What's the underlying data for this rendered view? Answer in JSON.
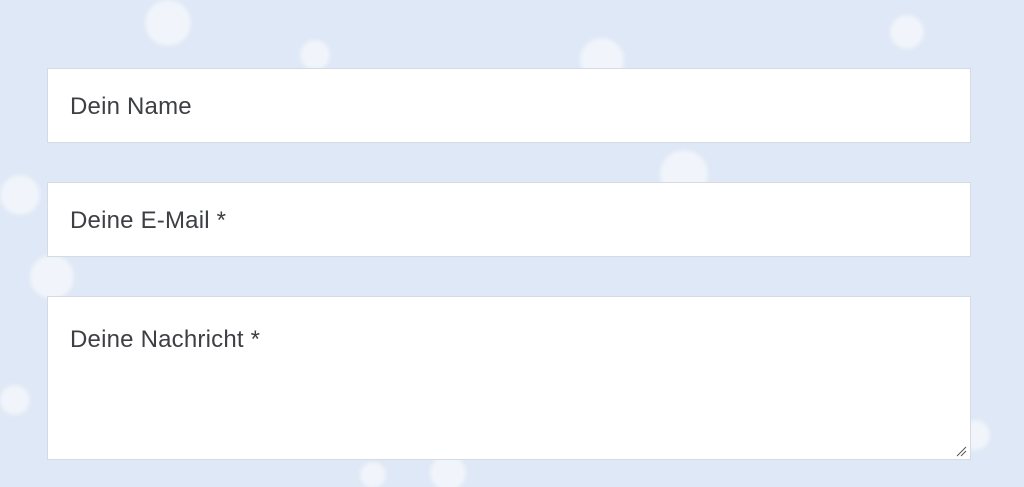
{
  "form": {
    "name_placeholder": "Dein Name",
    "email_placeholder": "Deine E-Mail *",
    "message_placeholder": "Deine Nachricht *"
  },
  "colors": {
    "background": "#dfe8f6",
    "field_background": "#ffffff",
    "field_border": "#d6dbe3",
    "text": "#3e3f44"
  },
  "icons": {
    "resize": "resize-grip-icon"
  }
}
